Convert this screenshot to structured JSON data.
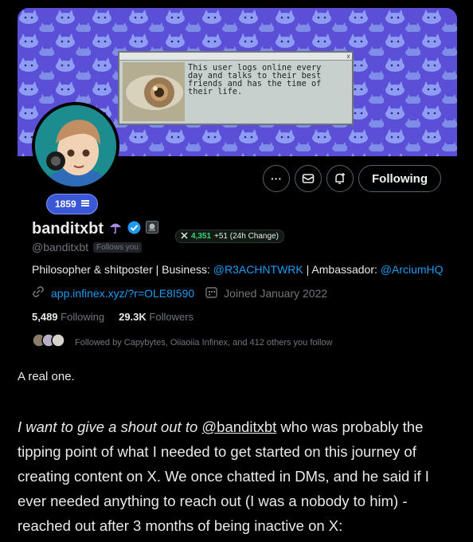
{
  "banner": {
    "retro_window_close": "x",
    "retro_window_text": "This user logs online every\nday and talks to their best\nfriends and has the time of\ntheir life."
  },
  "profile": {
    "level_badge": "1859",
    "display_name": "banditxbt",
    "handle": "@banditxbt",
    "follows_you": "Follows you",
    "score": "4,351",
    "score_change": "+51 (24h Change)",
    "bio_parts": {
      "p1": "Philosopher & shitposter | Business: ",
      "m1": "@R3ACHNTWRK",
      "p2": " | Ambassador: ",
      "m2": "@ArciumHQ"
    },
    "website": "app.infinex.xyz/?r=OLE8I590",
    "joined": "Joined January 2022",
    "following_count": "5,489",
    "following_label": "Following",
    "followers_count": "29.3K",
    "followers_label": "Followers",
    "followed_by": "Followed by Capybytes, Oiiaoiia Infinex, and 412 others you follow"
  },
  "actions": {
    "more_label": "···",
    "following_button": "Following"
  },
  "caption": "A real one.",
  "post": {
    "part1": "I want to give a shout out to ",
    "mention": "@banditxbt",
    "part2": " who was probably the tipping point of what  I needed to get started on this journey of creating content on X. We once chatted in DMs, and he said if I ever needed anything to reach out (I was a nobody to him) - reached out after 3 months of being inactive on X:"
  },
  "colors": {
    "accent_blue": "#1d9bf0",
    "banner_bg": "#5a4fd6",
    "avatar_bg": "#1c8c8f",
    "score_green": "#3fd07a"
  }
}
